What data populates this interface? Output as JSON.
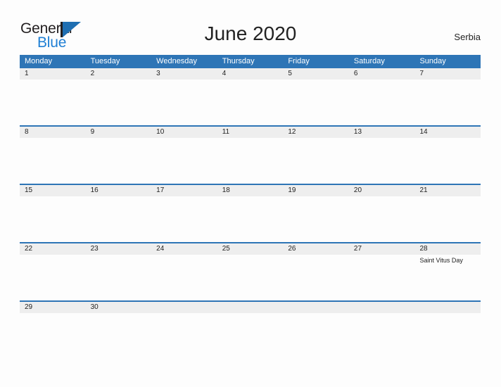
{
  "logo": {
    "word_top": "General",
    "word_bottom": "Blue",
    "mark": "triangle-logo-mark",
    "accent_color": "#1f7fd4"
  },
  "header": {
    "title": "June 2020",
    "country": "Serbia"
  },
  "theme": {
    "header_blue": "#2e75b6",
    "date_band_gray": "#eeeeee",
    "rule_blue": "#2e75b6",
    "page_background": "#fdfdfd",
    "text": "#222222"
  },
  "calendar": {
    "weekday_headers": [
      "Monday",
      "Tuesday",
      "Wednesday",
      "Thursday",
      "Friday",
      "Saturday",
      "Sunday"
    ],
    "weeks": [
      {
        "days": [
          {
            "date": "1",
            "events": []
          },
          {
            "date": "2",
            "events": []
          },
          {
            "date": "3",
            "events": []
          },
          {
            "date": "4",
            "events": []
          },
          {
            "date": "5",
            "events": []
          },
          {
            "date": "6",
            "events": []
          },
          {
            "date": "7",
            "events": []
          }
        ]
      },
      {
        "days": [
          {
            "date": "8",
            "events": []
          },
          {
            "date": "9",
            "events": []
          },
          {
            "date": "10",
            "events": []
          },
          {
            "date": "11",
            "events": []
          },
          {
            "date": "12",
            "events": []
          },
          {
            "date": "13",
            "events": []
          },
          {
            "date": "14",
            "events": []
          }
        ]
      },
      {
        "days": [
          {
            "date": "15",
            "events": []
          },
          {
            "date": "16",
            "events": []
          },
          {
            "date": "17",
            "events": []
          },
          {
            "date": "18",
            "events": []
          },
          {
            "date": "19",
            "events": []
          },
          {
            "date": "20",
            "events": []
          },
          {
            "date": "21",
            "events": []
          }
        ]
      },
      {
        "days": [
          {
            "date": "22",
            "events": []
          },
          {
            "date": "23",
            "events": []
          },
          {
            "date": "24",
            "events": []
          },
          {
            "date": "25",
            "events": []
          },
          {
            "date": "26",
            "events": []
          },
          {
            "date": "27",
            "events": []
          },
          {
            "date": "28",
            "events": [
              "Saint Vitus Day"
            ]
          }
        ]
      },
      {
        "days": [
          {
            "date": "29",
            "events": []
          },
          {
            "date": "30",
            "events": []
          },
          {
            "date": "",
            "events": []
          },
          {
            "date": "",
            "events": []
          },
          {
            "date": "",
            "events": []
          },
          {
            "date": "",
            "events": []
          },
          {
            "date": "",
            "events": []
          }
        ]
      }
    ]
  }
}
